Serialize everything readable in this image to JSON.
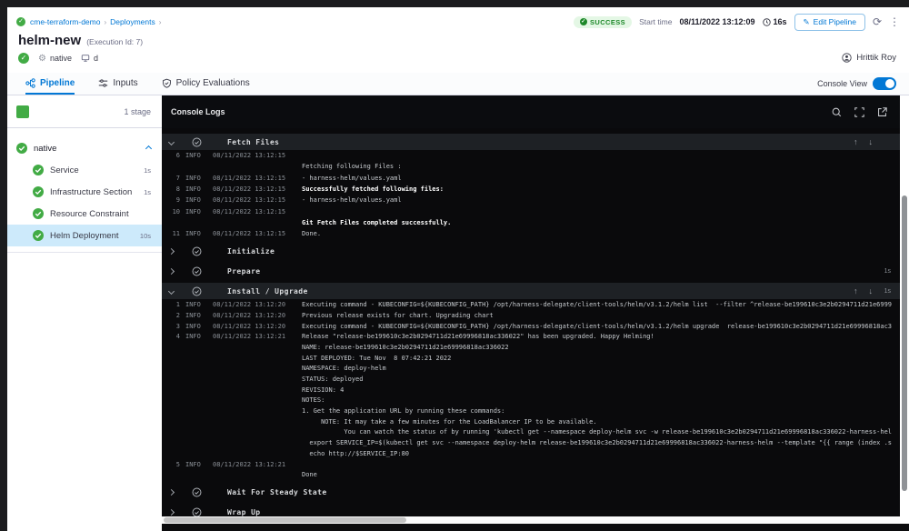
{
  "header": {
    "breadcrumb": {
      "project": "cme-terraform-demo",
      "section": "Deployments",
      "separator": "›"
    },
    "title": "helm-new",
    "execution_id": "(Execution Id: 7)",
    "service_tag": "native",
    "env_tag": "d",
    "status_badge": "SUCCESS",
    "start_time_label": "Start time",
    "start_time_value": "08/11/2022 13:12:09",
    "duration": "16s",
    "edit_pipeline_label": "Edit Pipeline",
    "user_name": "Hrittik Roy"
  },
  "tabs": {
    "pipeline": "Pipeline",
    "inputs": "Inputs",
    "policy": "Policy Evaluations",
    "console_view_label": "Console View",
    "console_view_on": true
  },
  "sidebar": {
    "stage_count": "1 stage",
    "stage_name": "native",
    "steps": [
      {
        "label": "Service",
        "duration": "1s"
      },
      {
        "label": "Infrastructure Section",
        "duration": "1s"
      },
      {
        "label": "Resource Constraint",
        "duration": ""
      },
      {
        "label": "Helm Deployment",
        "duration": "10s",
        "selected": true
      }
    ]
  },
  "console": {
    "title": "Console Logs",
    "sections": [
      {
        "name": "Fetch Files",
        "state": "expanded",
        "duration": "",
        "rows": [
          {
            "num": "6",
            "level": "INFO",
            "time": "08/11/2022 13:12:15",
            "msg": ""
          },
          {
            "num": "",
            "level": "",
            "time": "",
            "msg": "Fetching following Files :"
          },
          {
            "num": "7",
            "level": "INFO",
            "time": "08/11/2022 13:12:15",
            "msg": "- harness-helm/values.yaml"
          },
          {
            "num": "8",
            "level": "INFO",
            "time": "08/11/2022 13:12:15",
            "msg": "Successfully fetched following files:",
            "bold": true
          },
          {
            "num": "9",
            "level": "INFO",
            "time": "08/11/2022 13:12:15",
            "msg": "- harness-helm/values.yaml"
          },
          {
            "num": "10",
            "level": "INFO",
            "time": "08/11/2022 13:12:15",
            "msg": ""
          },
          {
            "num": "",
            "level": "",
            "time": "",
            "msg": "Git Fetch Files completed successfully.",
            "bold": true
          },
          {
            "num": "11",
            "level": "INFO",
            "time": "08/11/2022 13:12:15",
            "msg": "Done."
          }
        ]
      },
      {
        "name": "Initialize",
        "state": "collapsed",
        "duration": ""
      },
      {
        "name": "Prepare",
        "state": "collapsed",
        "duration": "1s"
      },
      {
        "name": "Install / Upgrade",
        "state": "expanded",
        "duration": "1s",
        "rows": [
          {
            "num": "1",
            "level": "INFO",
            "time": "08/11/2022 13:12:20",
            "msg": "Executing command - KUBECONFIG=${KUBECONFIG_PATH} /opt/harness-delegate/client-tools/helm/v3.1.2/helm list  --filter ^release-be199610c3e2b0294711d21e6999"
          },
          {
            "num": "2",
            "level": "INFO",
            "time": "08/11/2022 13:12:20",
            "msg": "Previous release exists for chart. Upgrading chart"
          },
          {
            "num": "3",
            "level": "INFO",
            "time": "08/11/2022 13:12:20",
            "msg": "Executing command - KUBECONFIG=${KUBECONFIG_PATH} /opt/harness-delegate/client-tools/helm/v3.1.2/helm upgrade  release-be199610c3e2b0294711d21e69996818ac3"
          },
          {
            "num": "4",
            "level": "INFO",
            "time": "08/11/2022 13:12:21",
            "msg": "Release \"release-be199610c3e2b0294711d21e69996818ac336022\" has been upgraded. Happy Helming!"
          },
          {
            "num": "",
            "level": "",
            "time": "",
            "msg": "NAME: release-be199610c3e2b0294711d21e69996818ac336022"
          },
          {
            "num": "",
            "level": "",
            "time": "",
            "msg": "LAST DEPLOYED: Tue Nov  8 07:42:21 2022"
          },
          {
            "num": "",
            "level": "",
            "time": "",
            "msg": "NAMESPACE: deploy-helm"
          },
          {
            "num": "",
            "level": "",
            "time": "",
            "msg": "STATUS: deployed"
          },
          {
            "num": "",
            "level": "",
            "time": "",
            "msg": "REVISION: 4"
          },
          {
            "num": "",
            "level": "",
            "time": "",
            "msg": "NOTES:"
          },
          {
            "num": "",
            "level": "",
            "time": "",
            "msg": "1. Get the application URL by running these commands:"
          },
          {
            "num": "",
            "level": "",
            "time": "",
            "msg": "     NOTE: It may take a few minutes for the LoadBalancer IP to be available."
          },
          {
            "num": "",
            "level": "",
            "time": "",
            "msg": "           You can watch the status of by running 'kubectl get --namespace deploy-helm svc -w release-be199610c3e2b0294711d21e69996818ac336022-harness-hel"
          },
          {
            "num": "",
            "level": "",
            "time": "",
            "msg": "  export SERVICE_IP=$(kubectl get svc --namespace deploy-helm release-be199610c3e2b0294711d21e69996818ac336022-harness-helm --template \"{{ range (index .s"
          },
          {
            "num": "",
            "level": "",
            "time": "",
            "msg": "  echo http://$SERVICE_IP:80"
          },
          {
            "num": "5",
            "level": "INFO",
            "time": "08/11/2022 13:12:21",
            "msg": ""
          },
          {
            "num": "",
            "level": "",
            "time": "",
            "msg": "Done"
          }
        ]
      },
      {
        "name": "Wait For Steady State",
        "state": "collapsed",
        "duration": ""
      },
      {
        "name": "Wrap Up",
        "state": "collapsed",
        "duration": ""
      }
    ]
  },
  "colors": {
    "accent_blue": "#0278d5",
    "success_green": "#42ab45",
    "badge_bg": "#e4f7e5",
    "badge_text": "#1e892a",
    "console_bg": "#0a0a0c",
    "section_header_bg": "#1e2125",
    "selected_step_bg": "#cdeafb"
  }
}
